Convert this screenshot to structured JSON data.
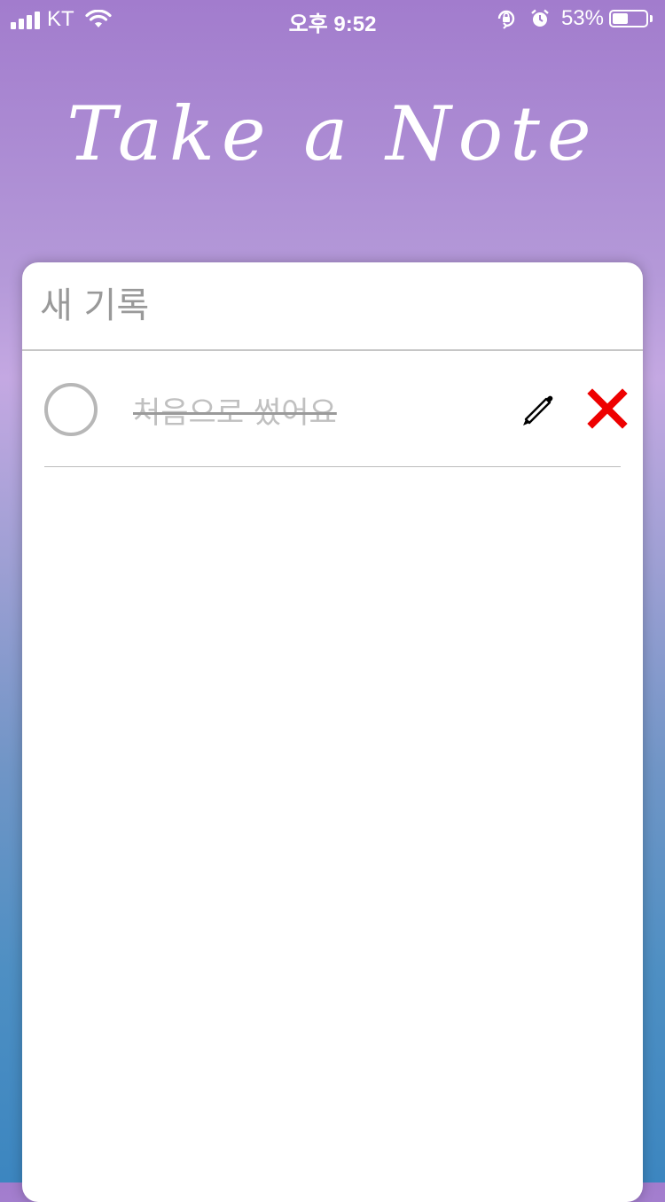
{
  "status_bar": {
    "carrier": "KT",
    "time": "오후 9:52",
    "battery": "53%",
    "battery_level": 0.53,
    "icons": [
      "signal-icon",
      "wifi-icon",
      "orientation-lock-icon",
      "alarm-icon",
      "battery-icon"
    ]
  },
  "header": {
    "title": "Take a Note"
  },
  "input": {
    "placeholder": "새 기록",
    "value": ""
  },
  "notes": [
    {
      "text": "처음으로 썼어요",
      "completed": true
    }
  ],
  "actions": {
    "edit_icon": "pencil-icon",
    "delete_icon": "close-icon"
  },
  "colors": {
    "gradient_top": "#a27ccd",
    "gradient_bottom": "#3c86c0",
    "delete": "#ee0000",
    "completed_text": "#c0c0c0"
  }
}
